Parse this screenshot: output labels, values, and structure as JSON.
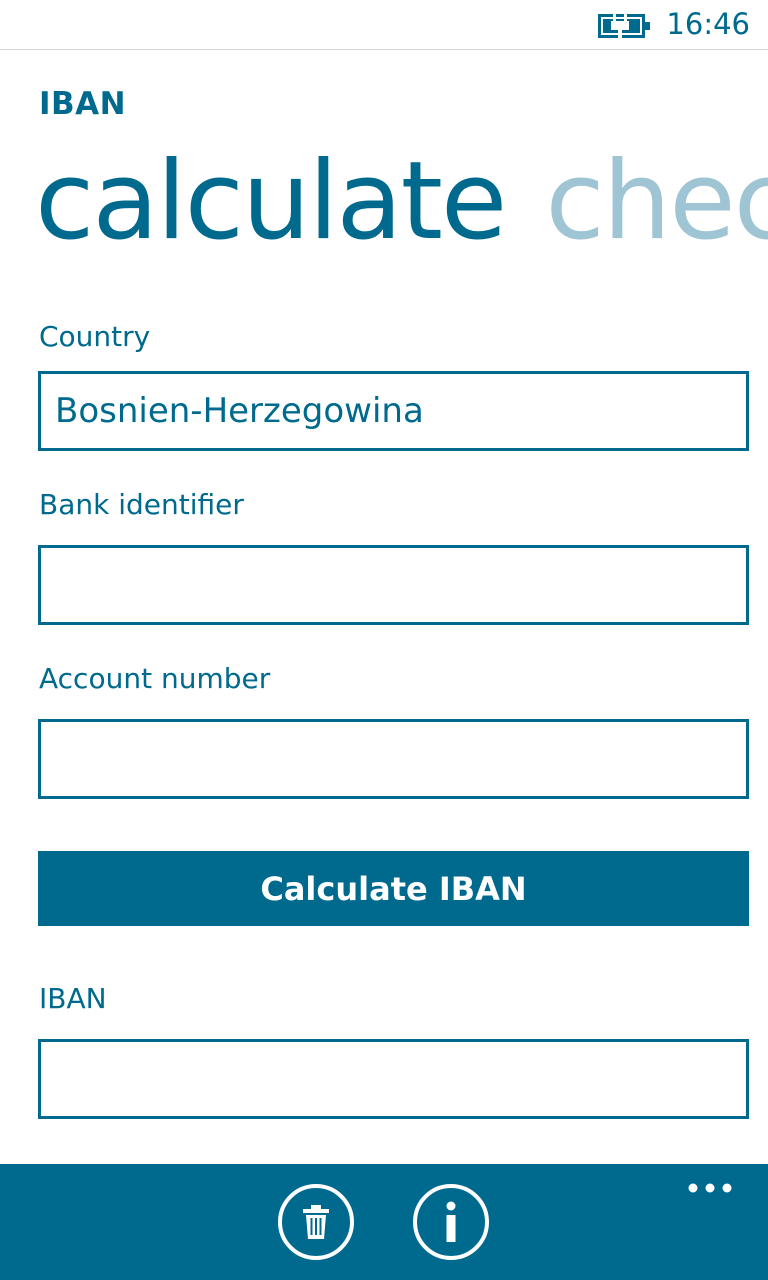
{
  "status_bar": {
    "time": "16:46",
    "battery_icon": "battery-charging-icon"
  },
  "app": {
    "title": "IBAN"
  },
  "pivot": {
    "items": [
      {
        "label": "calculate",
        "active": true
      },
      {
        "label": "check",
        "active": false
      }
    ]
  },
  "form": {
    "country": {
      "label": "Country",
      "value": "Bosnien-Herzegowina"
    },
    "bank_identifier": {
      "label": "Bank identifier",
      "value": ""
    },
    "account_number": {
      "label": "Account number",
      "value": ""
    },
    "calculate_button": "Calculate IBAN",
    "iban": {
      "label": "IBAN",
      "value": ""
    }
  },
  "app_bar": {
    "buttons": [
      {
        "icon": "trash-icon"
      },
      {
        "icon": "info-icon"
      }
    ],
    "more_icon": "more-icon"
  },
  "colors": {
    "accent": "#006a8e",
    "inactive_pivot": "#9fc4d3",
    "background": "#ffffff"
  }
}
